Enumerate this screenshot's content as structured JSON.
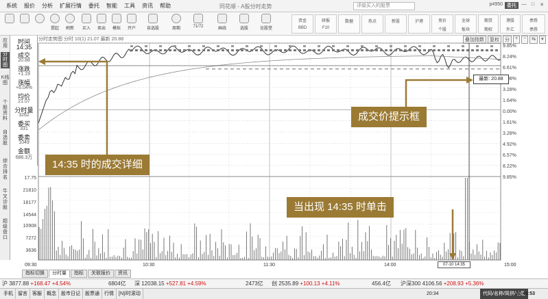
{
  "menubar": {
    "items": [
      "系统",
      "报价",
      "分析",
      "扩展行情",
      "委托",
      "智能",
      "工具",
      "资讯",
      "帮助"
    ],
    "title": "同花顺 - A股分时走势",
    "search_placeholder": "评级买入的股票",
    "window_controls": [
      "p4950",
      "—",
      "□",
      "✕"
    ],
    "mode_label": "委托"
  },
  "toolbar": {
    "left_buttons": [
      "",
      "",
      "",
      "",
      "",
      "",
      "",
      "",
      "",
      "",
      "",
      "",
      "",
      "",
      "",
      "",
      ""
    ],
    "left_labels": [
      "",
      "",
      "",
      "提起",
      "刷新",
      "买入",
      "卖出",
      "模拟",
      "开户",
      "自选股",
      "周期",
      "71/72",
      "画线",
      "选股",
      "论股堂",
      "",
      "",
      ""
    ],
    "right_groups": [
      {
        "top": "资金",
        "bottom": "BBD"
      },
      {
        "top": "研报",
        "bottom": "F10"
      },
      {
        "top": "",
        "bottom": "数据"
      },
      {
        "top": "",
        "bottom": "热点"
      },
      {
        "top": "",
        "bottom": "新股"
      },
      {
        "top": "",
        "bottom": "沪港"
      },
      {
        "top": "竞价",
        "bottom": "个股"
      },
      {
        "top": "全球",
        "bottom": "板块"
      },
      {
        "top": "期货",
        "bottom": "期权"
      },
      {
        "top": "基金",
        "bottom": "基金"
      },
      {
        "top": "港股",
        "bottom": "外汇"
      },
      {
        "top": "债券",
        "bottom": "债券"
      }
    ]
  },
  "sidetabs": [
    "应用",
    "分时图",
    "K线图",
    "个股资料",
    "自选股",
    "综合排名",
    "牛叉诊股",
    "超级盘口"
  ],
  "info": {
    "time_label": "时间",
    "time_value": "14:35",
    "price_label": "成交",
    "price_value": "20.88",
    "change_label": "涨跌",
    "change_value": "+1.19",
    "pct_label": "涨幅",
    "pct_value": "+6.04%",
    "avg_label": "均价",
    "avg_value": "21.07",
    "vol_label": "分时量",
    "vol_value": "3262",
    "outer_label": "委买",
    "outer_value": "331",
    "inner_label": "委卖",
    "inner_value": "1049",
    "amount_label": "金额",
    "amount_value": "686.3万"
  },
  "chart": {
    "header": "分时走势图  分时 10(1) 21.07 最新 20.88",
    "tools": [
      "叠加指数",
      "复权",
      "分",
      "+",
      "−",
      "⇆",
      "▾"
    ],
    "tooltip_label": "最新: 20.88",
    "time_tip": "07-10 14:35",
    "pct_axis": [
      "9.85%",
      "8.24%",
      "6.61%",
      "4.98%",
      "3.28%",
      "1.64%",
      "0.00%",
      "1.61%",
      "3.28%",
      "4.92%",
      "6.57%",
      "8.22%",
      "9.85%"
    ],
    "vol_axis": [
      "17.75",
      "21810",
      "18177",
      "14544",
      "10908",
      "7272",
      "3636"
    ],
    "time_axis": [
      "09:30",
      "10:30",
      "11:30",
      "14:00",
      "15:00"
    ]
  },
  "callouts": {
    "detail": "14:35 时的成交详细",
    "tooltip": "成交价提示框",
    "click": "当出现 14:35 时单击"
  },
  "bottom_tabs": [
    "指标切换",
    "分时量",
    "指标",
    "关联报价",
    "资讯"
  ],
  "index_row": [
    {
      "name": "沪",
      "value": "3877.88",
      "change": "+168.47",
      "pct": "+4.54%"
    },
    {
      "name": "",
      "value": "6804亿",
      "change": "",
      "pct": ""
    },
    {
      "name": "深",
      "value": "12038.15",
      "change": "+527.81",
      "pct": "+4.59%"
    },
    {
      "name": "",
      "value": "2473亿",
      "change": "",
      "pct": ""
    },
    {
      "name": "创",
      "value": "2535.89",
      "change": "+100.13",
      "pct": "+4.11%"
    },
    {
      "name": "",
      "value": "456.4亿",
      "change": "",
      "pct": ""
    },
    {
      "name": "沪深300",
      "value": "4106.56",
      "change": "+208.93",
      "pct": "+5.36%"
    }
  ],
  "status": {
    "left": [
      "手机",
      "留言",
      "客服",
      "概念",
      "股市日记",
      "股票通",
      "行情",
      "[N]/时滚动"
    ],
    "mid": "20:34",
    "right": "代码/名称/简拼/功能",
    "clock": "20:45:53"
  },
  "chart_data": {
    "type": "line",
    "x": [
      "09:30",
      "10:30",
      "11:30",
      "14:00",
      "15:00"
    ],
    "selected_time": "14:35",
    "selected_price": 20.88
  }
}
